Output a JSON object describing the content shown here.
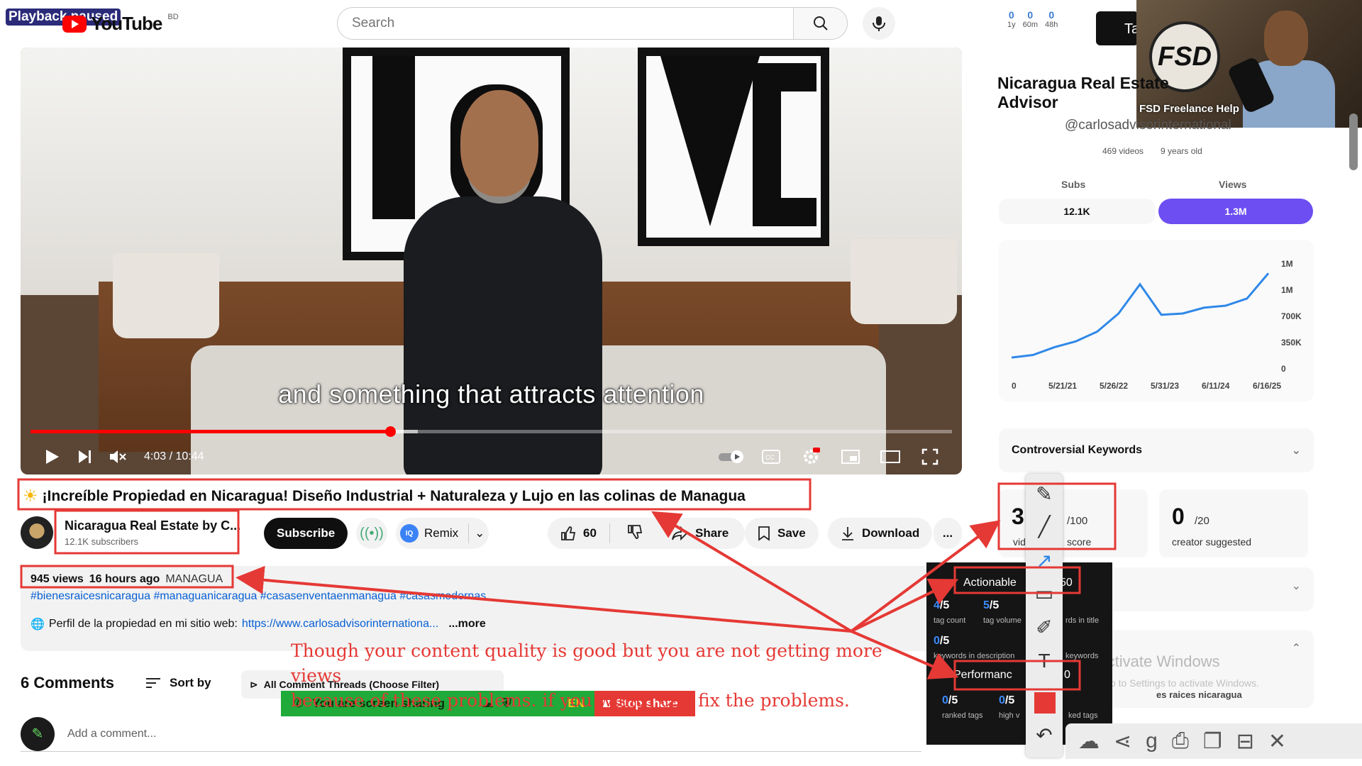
{
  "overlay": {
    "badge": "Playback paused"
  },
  "header": {
    "logo_text": "YouTube",
    "country_code": "BD",
    "search_placeholder": "Search"
  },
  "ext_stats": [
    {
      "value": "0",
      "label": "1y"
    },
    {
      "value": "0",
      "label": "60m"
    },
    {
      "value": "0",
      "label": "48h"
    }
  ],
  "header_button_partial": "Ta",
  "webcam": {
    "logo_text": "FSD",
    "name": "FSD Freelance Help"
  },
  "player": {
    "caption": "and something that attracts attention",
    "time": "4:03 / 10:44",
    "progress_fraction": 0.39,
    "buffered_fraction": 0.42
  },
  "video": {
    "title": "¡Increíble Propiedad en Nicaragua! Diseño Industrial + Naturaleza y Lujo en las colinas de Managua",
    "channel_name": "Nicaragua Real Estate by C...",
    "subscribers": "12.1K subscribers",
    "subscribe_label": "Subscribe",
    "remix_label": "Remix",
    "remix_badge": "IQ",
    "likes": "60",
    "share_label": "Share",
    "save_label": "Save",
    "download_label": "Download",
    "more_actions": "..."
  },
  "description": {
    "views": "945 views",
    "age": "16 hours ago",
    "location": "MANAGUA",
    "hashtags": "#bienesraicesnicaragua #managuanicaragua #casasenventaenmanagua #casasmodernas",
    "line2_prefix": "Perfil de la propiedad en mi sitio web:",
    "line2_link": "https://www.carlosadvisorinternationa...",
    "more": "...more"
  },
  "comments": {
    "count_label": "6 Comments",
    "sort_label": "Sort by",
    "filter_label": "All Comment Threads (Choose Filter)",
    "add_placeholder": "Add a comment..."
  },
  "screenshare": {
    "message": "You are screen sharing",
    "lang": "EN",
    "stop_label": "Stop share"
  },
  "sidebar": {
    "channel_title": "Nicaragua Real Estate Advisor",
    "handle": "@carlosadvisorinternational",
    "videos": "469 videos",
    "age": "9 years old",
    "subs_label": "Subs",
    "views_label": "Views",
    "subs_value": "12.1K",
    "views_value": "1.3M",
    "keywords_section": "Controversial Keywords",
    "score_card1_num": "3",
    "score_card1_sub1": "vid",
    "score_card1_sub2": "/100",
    "score_card1_sub3": "score",
    "score_card2_num": "0",
    "score_card2_sub": "/20",
    "score_card2_caption": "creator suggested",
    "section_label_partial": "nt",
    "raices": "es raices nicaragua",
    "activate_title": "Activate Windows",
    "activate_sub": "Go to Settings to activate Windows."
  },
  "chart_data": {
    "type": "line",
    "title": "",
    "x_ticks": [
      "0",
      "5/21/21",
      "5/26/22",
      "5/31/23",
      "6/11/24",
      "6/16/25"
    ],
    "y_ticks": [
      "0",
      "350K",
      "700K",
      "1M",
      "1M"
    ],
    "ylim": [
      0,
      1400000
    ],
    "series": [
      {
        "values": [
          [
            "5/21/21",
            20000
          ],
          [
            "2021-11",
            60000
          ],
          [
            "5/26/22",
            180000
          ],
          [
            "2022-11",
            270000
          ],
          [
            "5/31/23",
            420000
          ],
          [
            "2023-11",
            700000
          ],
          [
            "2024-04",
            1150000
          ],
          [
            "2024-04b",
            680000
          ],
          [
            "6/11/24",
            700000
          ],
          [
            "2024-09",
            790000
          ],
          [
            "2025-01",
            820000
          ],
          [
            "2025-04",
            930000
          ],
          [
            "6/16/25",
            1320000
          ]
        ]
      }
    ],
    "color": "#2f88e8",
    "grid": false
  },
  "tags_panel": {
    "actionable": "Actionable",
    "actionable_score_partial": "50",
    "g1": {
      "num": "4",
      "den": "/5",
      "cap": "tag count"
    },
    "g2": {
      "num": "5",
      "den": "/5",
      "cap": "tag volume"
    },
    "g3_cap": "rds in title",
    "g4": {
      "num": "0",
      "den": "/5",
      "cap": "keywords in description"
    },
    "g5_cap": "keywords",
    "performance": "Performanc",
    "perf_score_partial": "0",
    "g6": {
      "num": "0",
      "den": "/5",
      "cap": "ranked tags"
    },
    "g7": {
      "num": "0",
      "den": "/5",
      "cap": "high v"
    },
    "g8_cap": "ked tags"
  },
  "annotation_note": {
    "line1": "Though your content quality is good but you are not getting more views",
    "line2": "because of these problems. if you want I can fix the problems."
  },
  "colors": {
    "annotation": "#e53935",
    "accent": "#6c4ef2",
    "youtube_red": "#ff0000"
  }
}
